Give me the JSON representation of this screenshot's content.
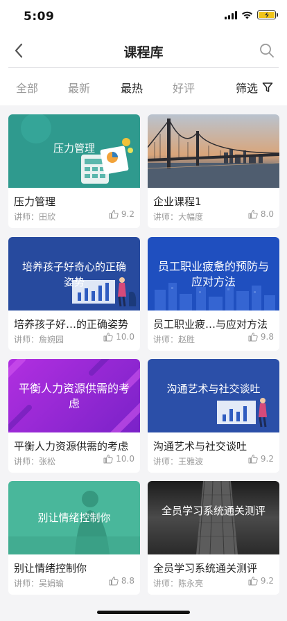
{
  "status": {
    "time": "5:09"
  },
  "nav": {
    "title": "课程库"
  },
  "tabs": [
    {
      "label": "全部"
    },
    {
      "label": "最新"
    },
    {
      "label": "最热"
    },
    {
      "label": "好评"
    }
  ],
  "filter": {
    "label": "筛选"
  },
  "courses": [
    {
      "title": "压力管理",
      "teacher": "讲师：田欣",
      "rating": "9.2",
      "thumb_text": "压力管理",
      "thumb_color": "#2f9a8e"
    },
    {
      "title": "企业课程1",
      "teacher": "讲师：大幅度",
      "rating": "8.0",
      "thumb_text": "",
      "thumb_color": "#c98a5a"
    },
    {
      "title": "培养孩子好…的正确姿势",
      "teacher": "讲师：詹婉园",
      "rating": "10.0",
      "thumb_text": "培养孩子好奇心的正确姿势",
      "thumb_color": "#274a9e"
    },
    {
      "title": "员工职业疲…与应对方法",
      "teacher": "讲师：赵胜",
      "rating": "9.8",
      "thumb_text": "员工职业疲惫的预防与应对方法",
      "thumb_color": "#1f4fbf"
    },
    {
      "title": "平衡人力资源供需的考虑",
      "teacher": "讲师：张松",
      "rating": "10.0",
      "thumb_text": "平衡人力资源供需的考虑",
      "thumb_color": "#9b2bd6"
    },
    {
      "title": "沟通艺术与社交谈吐",
      "teacher": "讲师：王雅波",
      "rating": "9.2",
      "thumb_text": "沟通艺术与社交谈吐",
      "thumb_color": "#2b4fa8"
    },
    {
      "title": "别让情绪控制你",
      "teacher": "讲师：吴娟瑜",
      "rating": "8.8",
      "thumb_text": "别让情绪控制你",
      "thumb_color": "#49b79b"
    },
    {
      "title": "全员学习系统通关测评",
      "teacher": "讲师：陈永亮",
      "rating": "9.2",
      "thumb_text": "全员学习系统通关测评",
      "thumb_color": "#3a3a3a"
    }
  ]
}
